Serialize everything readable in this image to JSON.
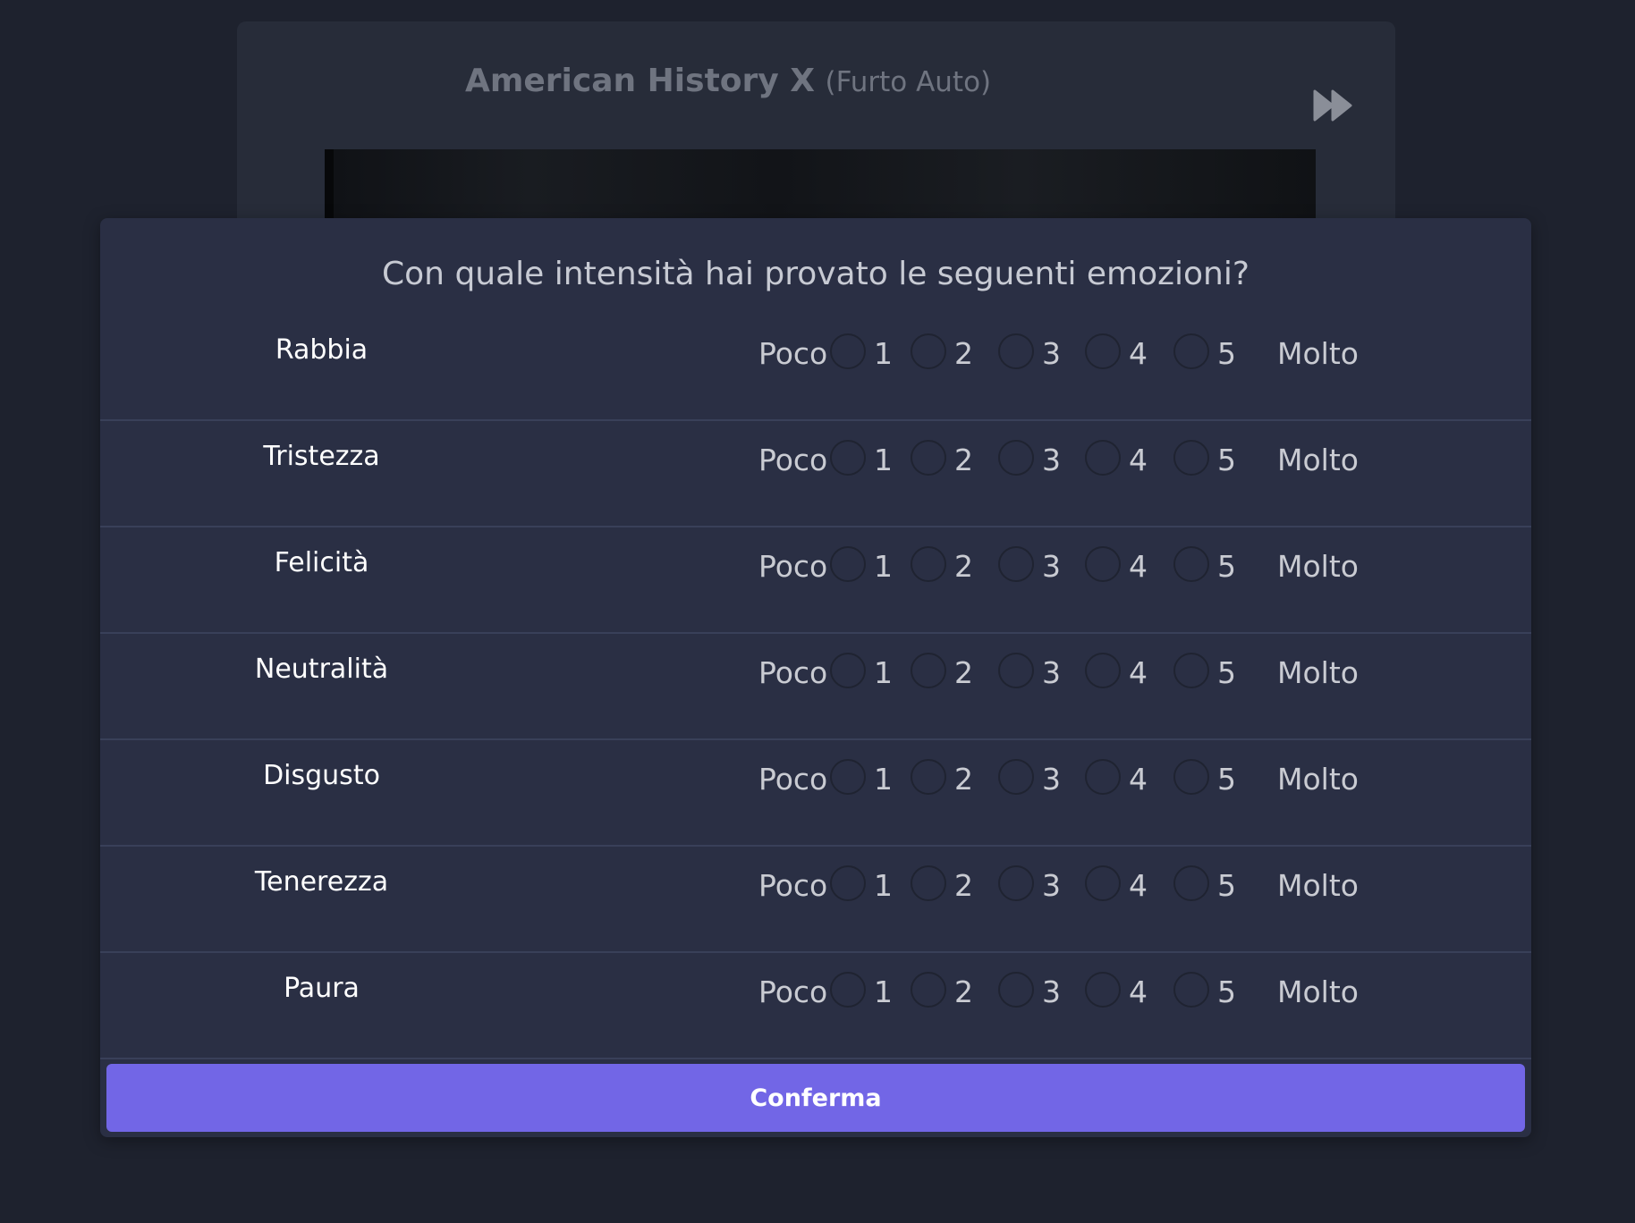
{
  "video": {
    "title": "American History X",
    "subtitle": "(Furto Auto)",
    "skip_icon": "fast-forward-icon"
  },
  "survey": {
    "question": "Con quale intensità hai provato le seguenti emozioni?",
    "scale_low": "Poco",
    "scale_high": "Molto",
    "options": [
      "1",
      "2",
      "3",
      "4",
      "5"
    ],
    "emotions": [
      "Rabbia",
      "Tristezza",
      "Felicità",
      "Neutralità",
      "Disgusto",
      "Tenerezza",
      "Paura"
    ]
  },
  "confirm_label": "Conferma",
  "colors": {
    "page_bg": "#1e222e",
    "card_bg": "#272c39",
    "modal_bg": "#2a2f44",
    "accent": "#7266e6"
  }
}
